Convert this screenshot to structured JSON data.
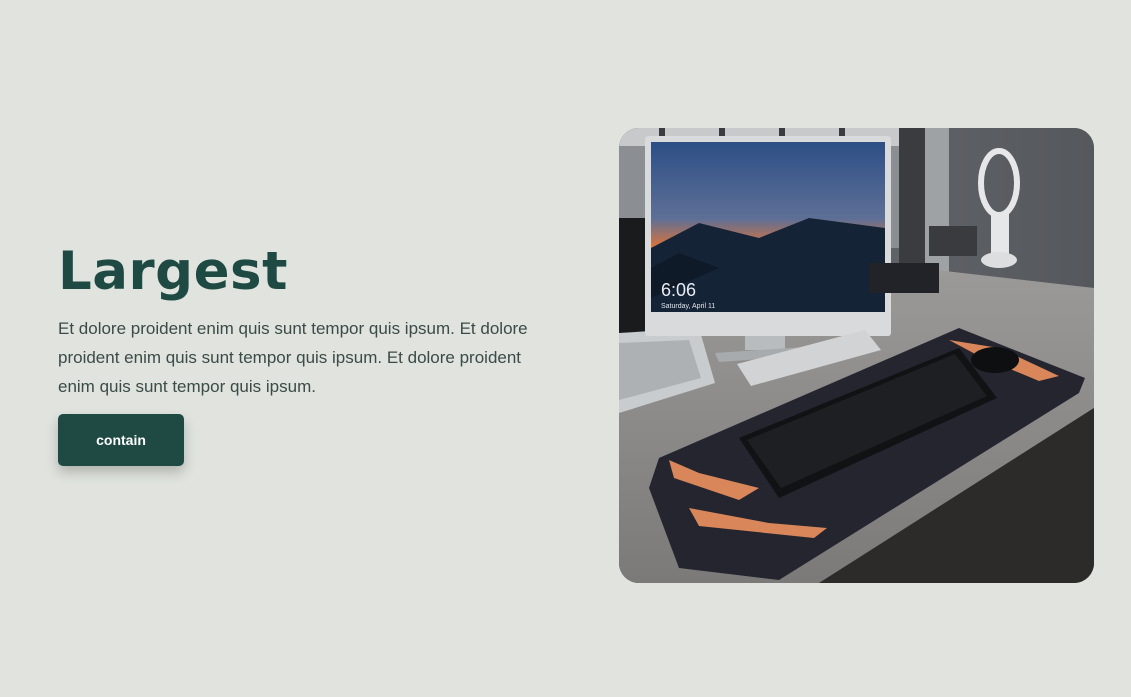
{
  "hero": {
    "title": "Largest",
    "body": "Et dolore proident enim quis sunt tempor quis ipsum. Et dolore proident enim quis sunt tempor quis ipsum. Et dolore proident enim quis sunt tempor quis ipsum.",
    "button_label": "contain"
  },
  "photo": {
    "subject": "desk setup with monitor, laptop and keyboard",
    "screen_time": "6:06",
    "screen_date": "Saturday, April 11"
  },
  "colors": {
    "background": "#e0e3de",
    "accent": "#1f4a44",
    "body_text": "#3b4b48"
  }
}
